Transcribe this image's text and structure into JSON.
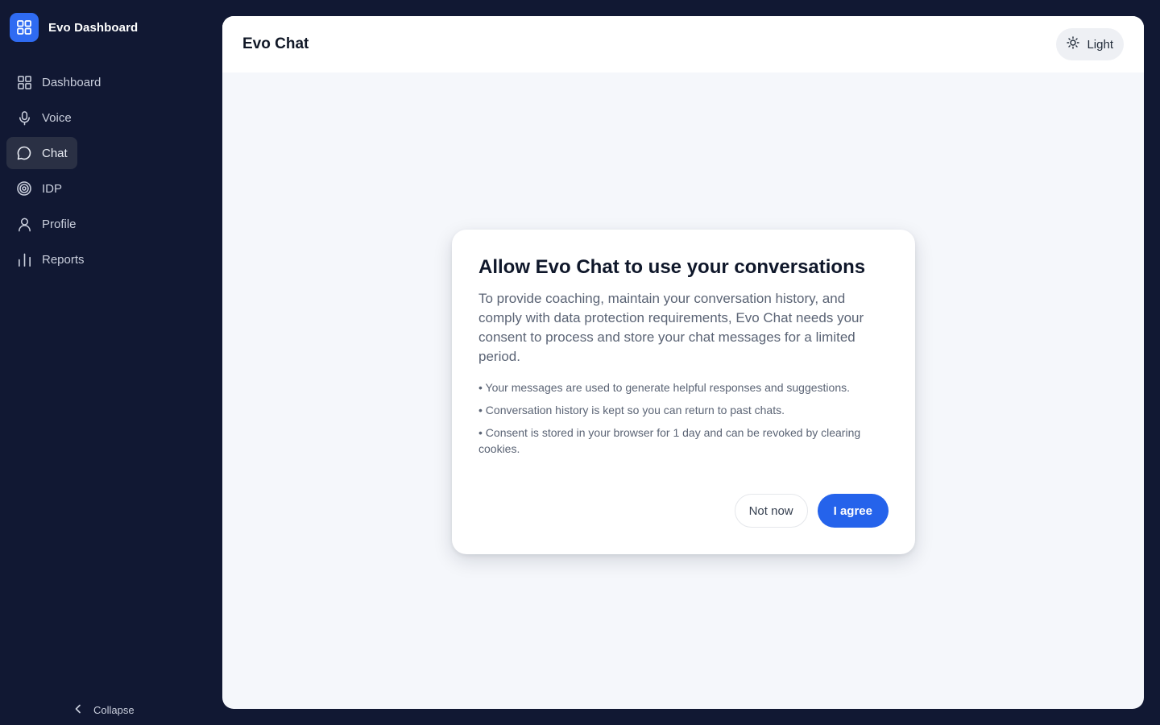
{
  "brand": {
    "title": "Evo Dashboard",
    "icon": "grid-icon"
  },
  "sidebar": {
    "items": [
      {
        "label": "Dashboard",
        "icon": "grid-icon",
        "active": false
      },
      {
        "label": "Voice",
        "icon": "microphone-icon",
        "active": false
      },
      {
        "label": "Chat",
        "icon": "chat-bubble-icon",
        "active": true
      },
      {
        "label": "IDP",
        "icon": "target-icon",
        "active": false
      },
      {
        "label": "Profile",
        "icon": "user-icon",
        "active": false
      },
      {
        "label": "Reports",
        "icon": "bar-chart-icon",
        "active": false
      }
    ],
    "collapse_label": "Collapse"
  },
  "header": {
    "title": "Evo Chat",
    "theme_label": "Light"
  },
  "modal": {
    "title": "Allow Evo Chat to use your conversations",
    "description": "To provide coaching, maintain your conversation history, and comply with data protection requirements, Evo Chat needs your consent to process and store your chat messages for a limited period.",
    "bullets": [
      "• Your messages are used to generate helpful responses and suggestions.",
      "• Conversation history is kept so you can return to past chats.",
      "• Consent is stored in your browser for 1 day and can be revoked by clearing cookies."
    ],
    "decline_label": "Not now",
    "accept_label": "I agree"
  },
  "colors": {
    "sidebar_bg": "#111833",
    "accent": "#2563eb",
    "brand_logo": "#2f6bf2",
    "active_item_bg": "#2a3044"
  }
}
